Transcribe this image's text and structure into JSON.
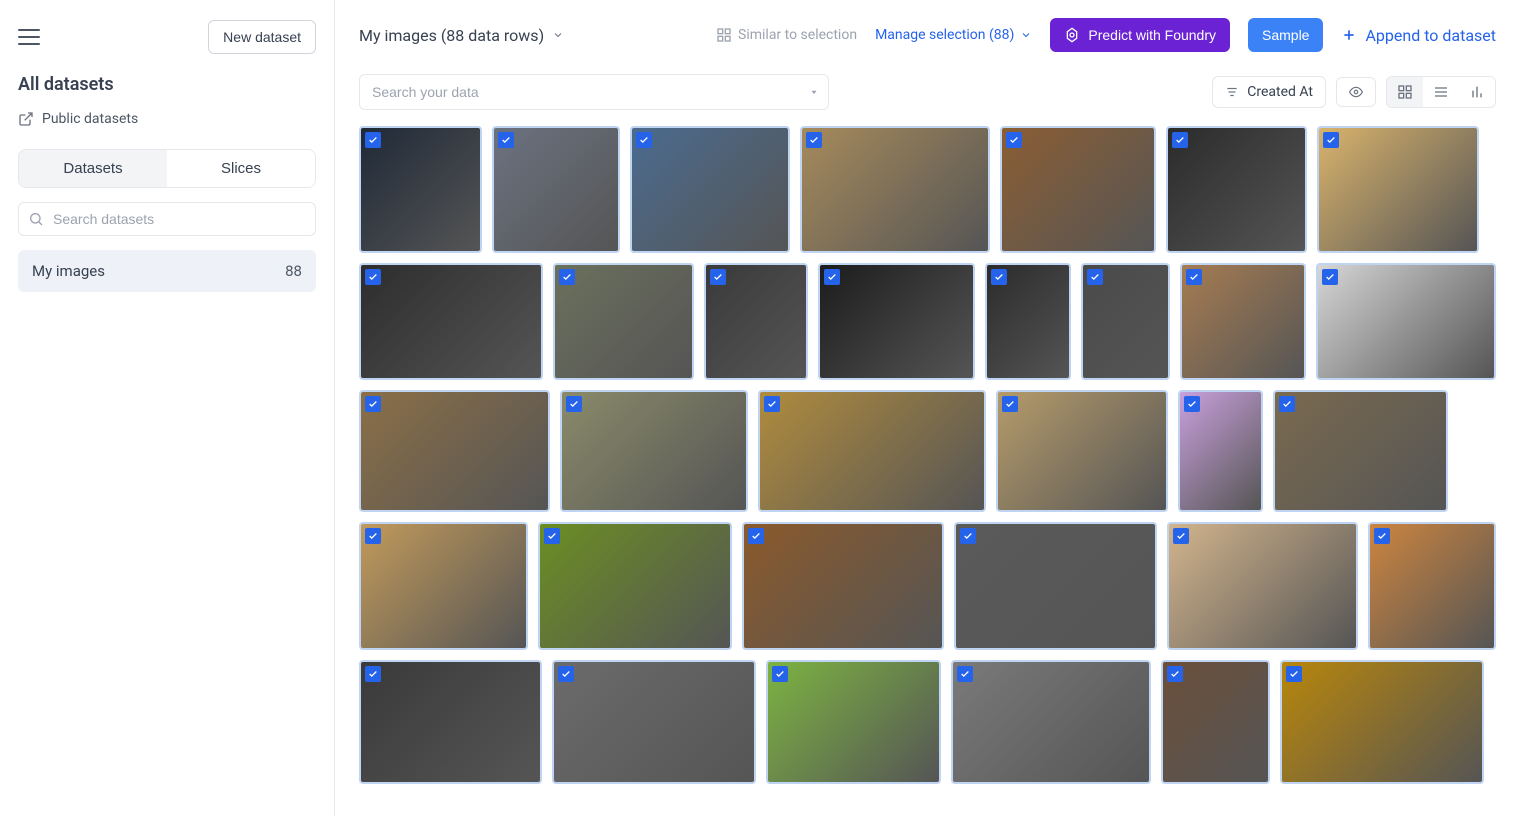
{
  "sidebar": {
    "new_dataset_label": "New dataset",
    "all_datasets_label": "All datasets",
    "public_datasets_label": "Public datasets",
    "tabs": {
      "datasets": "Datasets",
      "slices": "Slices"
    },
    "search_placeholder": "Search datasets",
    "dataset_row": {
      "name": "My images",
      "count": "88"
    }
  },
  "header": {
    "dataset_title": "My images (88 data rows)",
    "similar_label": "Similar to selection",
    "manage_label": "Manage selection (88)",
    "predict_label": "Predict with Foundry",
    "sample_label": "Sample",
    "append_label": "Append to dataset"
  },
  "filters": {
    "search_placeholder": "Search your data",
    "sort_label": "Created At"
  },
  "grid": {
    "rows": [
      {
        "heights": 127,
        "widths": [
          123,
          128,
          160,
          190,
          156,
          141,
          162
        ]
      },
      {
        "heights": 117,
        "widths": [
          186,
          142,
          105,
          159,
          86,
          90,
          127,
          182
        ]
      },
      {
        "heights": 122,
        "widths": [
          191,
          188,
          228,
          172,
          85,
          175
        ]
      },
      {
        "heights": 128,
        "widths": [
          170,
          195,
          204,
          204,
          192,
          129
        ]
      },
      {
        "heights": 124,
        "widths": [
          183,
          204,
          175,
          200,
          109,
          204
        ]
      }
    ],
    "colors": [
      [
        "#1f2937",
        "#6b7280",
        "#4b6b8f",
        "#a68a5b",
        "#8b5e34",
        "#2b2b2b",
        "#d9b36c"
      ],
      [
        "#2d2d2d",
        "#6b705c",
        "#3a3a3a",
        "#1c1c1c",
        "#2b2b2b",
        "#4a4a4a",
        "#a67c52",
        "#d6d6d6"
      ],
      [
        "#8b6f47",
        "#8a8a6a",
        "#b08b3e",
        "#b59b6a",
        "#c9a0dc",
        "#7a6a4f"
      ],
      [
        "#c29a5b",
        "#6b8e23",
        "#8b5a2b",
        "#5a5a5a",
        "#d2b48c",
        "#cd853f"
      ],
      [
        "#3a3a3a",
        "#6b6b6b",
        "#7cb342",
        "#7a7a7a",
        "#6b4f3a",
        "#b8860b"
      ]
    ]
  }
}
